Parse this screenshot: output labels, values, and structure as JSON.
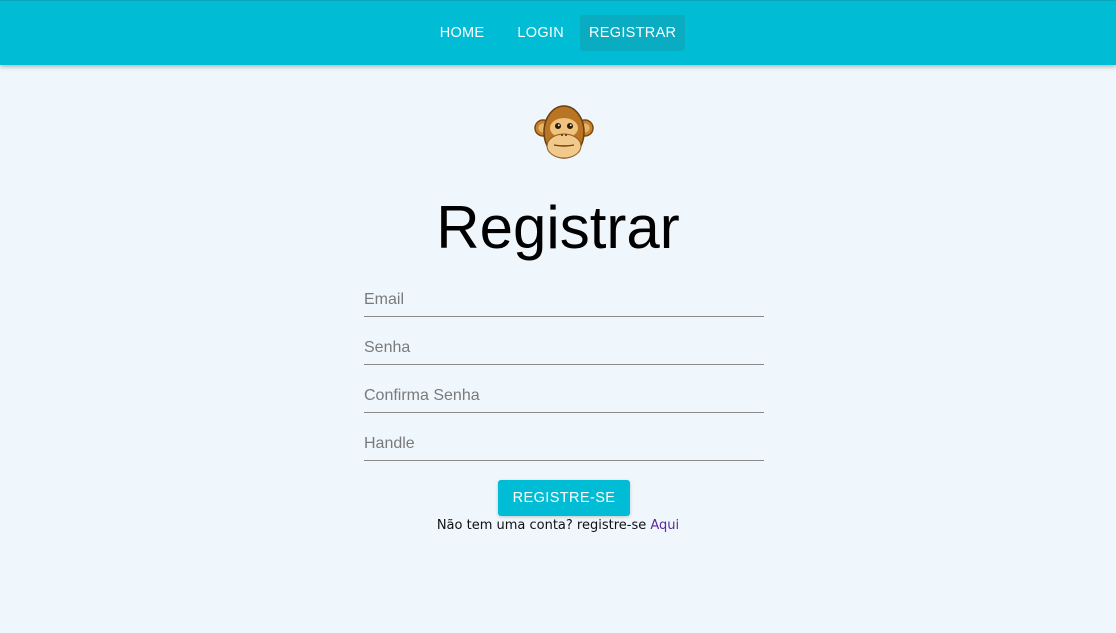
{
  "nav": {
    "home_label": "HOME",
    "login_label": "LOGIN",
    "register_label": "REGISTRAR",
    "active": "REGISTRAR"
  },
  "logo": {
    "icon": "monkey-face-icon"
  },
  "page": {
    "title": "Registrar"
  },
  "form": {
    "email_placeholder": "Email",
    "password_placeholder": "Senha",
    "confirm_password_placeholder": "Confirma Senha",
    "handle_placeholder": "Handle",
    "submit_label": "REGISTRE-SE"
  },
  "footer": {
    "prompt_text": "Não tem uma conta? registre-se ",
    "link_text": "Aqui"
  },
  "colors": {
    "accent": "#00bcd4",
    "background": "#eff7fd",
    "link": "#5a2a9c"
  }
}
